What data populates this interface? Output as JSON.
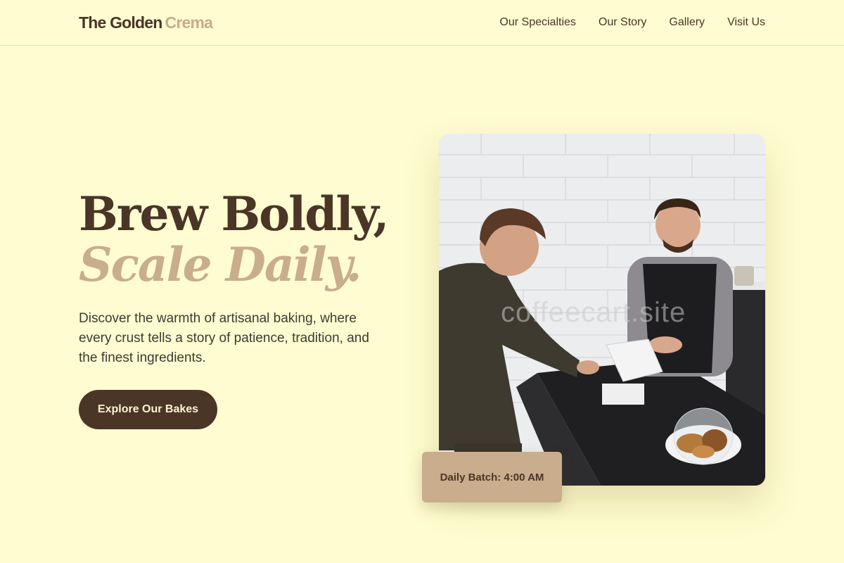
{
  "header": {
    "logo_part1": "The Golden",
    "logo_part2": "Crema",
    "nav": [
      {
        "label": "Our Specialties"
      },
      {
        "label": "Our Story"
      },
      {
        "label": "Gallery"
      },
      {
        "label": "Visit Us"
      }
    ]
  },
  "hero": {
    "headline_line1": "Brew Boldly,",
    "headline_line2": "Scale Daily.",
    "description": "Discover the warmth of artisanal baking, where every crust tells a story of patience, tradition, and the finest ingredients.",
    "cta_label": "Explore Our Bakes",
    "badge_text": "Daily Batch: 4:00 AM",
    "watermark_text": "coffeecart.site"
  },
  "colors": {
    "background": "#fefcd0",
    "primary_brown": "#4a3527",
    "accent_tan": "#c9ad8c"
  }
}
